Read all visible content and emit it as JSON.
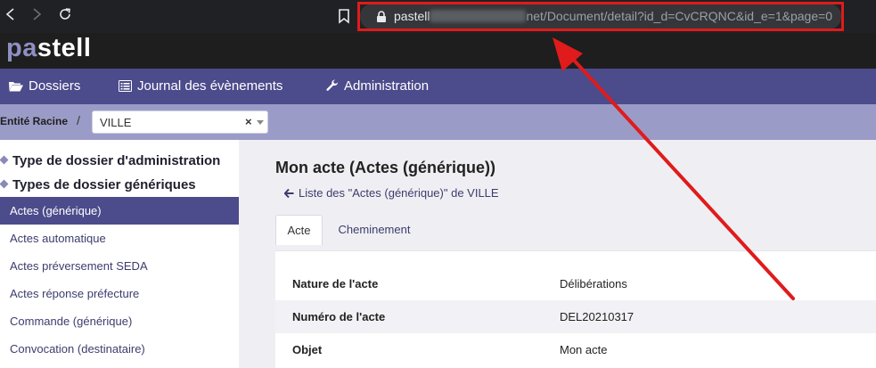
{
  "browser": {
    "url_host_start": "pastell",
    "url_rest": "net/Document/detail?id_d=CvCRQNC&id_e=1&page=0",
    "back_icon": "back-arrow-icon",
    "forward_icon": "forward-arrow-icon",
    "reload_icon": "reload-icon",
    "bookmark_icon": "bookmark-icon",
    "lock_icon": "lock-icon"
  },
  "app": {
    "logo_part1": "pa",
    "logo_part2": "stell"
  },
  "nav": {
    "items": [
      {
        "label": "Dossiers",
        "icon": "folder-open-icon"
      },
      {
        "label": "Journal des évènements",
        "icon": "list-alt-icon"
      },
      {
        "label": "Administration",
        "icon": "wrench-icon"
      }
    ]
  },
  "breadcrumb": {
    "label": "Entité Racine",
    "separator": "/",
    "select_value": "VILLE",
    "clear_symbol": "×"
  },
  "sidebar": {
    "headings": [
      "Type de dossier d'administration",
      "Types de dossier génériques"
    ],
    "items": [
      {
        "label": "Actes (générique)",
        "active": true
      },
      {
        "label": "Actes automatique",
        "active": false
      },
      {
        "label": "Actes préversement SEDA",
        "active": false
      },
      {
        "label": "Actes réponse préfecture",
        "active": false
      },
      {
        "label": "Commande (générique)",
        "active": false
      },
      {
        "label": "Convocation (destinataire)",
        "active": false
      }
    ]
  },
  "main": {
    "title": "Mon acte (Actes (générique))",
    "back_link": "Liste des \"Actes (générique)\" de VILLE",
    "tabs": [
      {
        "label": "Acte",
        "active": true
      },
      {
        "label": "Cheminement",
        "active": false
      }
    ],
    "rows": [
      {
        "label": "Nature de l'acte",
        "value": "Délibérations"
      },
      {
        "label": "Numéro de l'acte",
        "value": "DEL20210317"
      },
      {
        "label": "Objet",
        "value": "Mon acte"
      }
    ]
  },
  "colors": {
    "brand": "#4c4b8c",
    "brand_light": "#9b9bc8",
    "annotation": "#e01b1b"
  }
}
